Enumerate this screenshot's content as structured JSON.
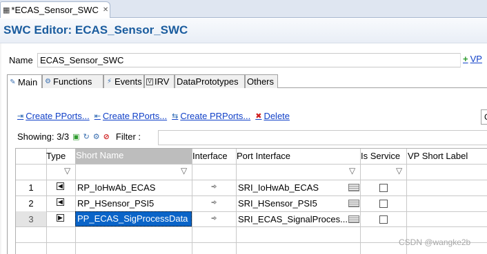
{
  "editor_tab": {
    "label": "*ECAS_Sensor_SWC",
    "icon": "swc-file-icon",
    "close": "✕"
  },
  "header": {
    "title": "SWC Editor: ECAS_Sensor_SWC"
  },
  "name_row": {
    "label": "Name",
    "value": "ECAS_Sensor_SWC",
    "vp_link": "VP"
  },
  "page_tabs": [
    {
      "label": "Main",
      "icon": "main-icon",
      "active": true
    },
    {
      "label": "Functions",
      "icon": "functions-icon"
    },
    {
      "label": "Events",
      "icon": "events-icon"
    },
    {
      "label": "IRV",
      "icon": "irv-icon"
    },
    {
      "label": "DataPrototypes"
    },
    {
      "label": "Others"
    }
  ],
  "actions": {
    "create_pports": "Create PPorts...",
    "create_rports": "Create RPorts...",
    "create_prports": "Create PRPorts...",
    "delete": "Delete",
    "right_combo": "C"
  },
  "filter_bar": {
    "showing": "Showing: 3/3",
    "filter_label": "Filter :"
  },
  "table": {
    "columns": [
      "Type",
      "Short Name",
      "Interface",
      "Port Interface",
      "Is Service",
      "VP Short Label"
    ],
    "rows": [
      {
        "num": "1",
        "type": "rport",
        "short_name": "RP_IoHwAb_ECAS",
        "port_interface": "SRI_IoHwAb_ECAS",
        "is_service": false
      },
      {
        "num": "2",
        "type": "rport",
        "short_name": "RP_HSensor_PSI5",
        "port_interface": "SRI_HSensor_PSI5",
        "is_service": false
      },
      {
        "num": "3",
        "type": "pport",
        "short_name": "PP_ECAS_SigProcessData",
        "port_interface": "SRI_ECAS_SignalProces...",
        "is_service": false,
        "selected": true
      }
    ]
  },
  "watermark": "CSDN @wangke2b"
}
